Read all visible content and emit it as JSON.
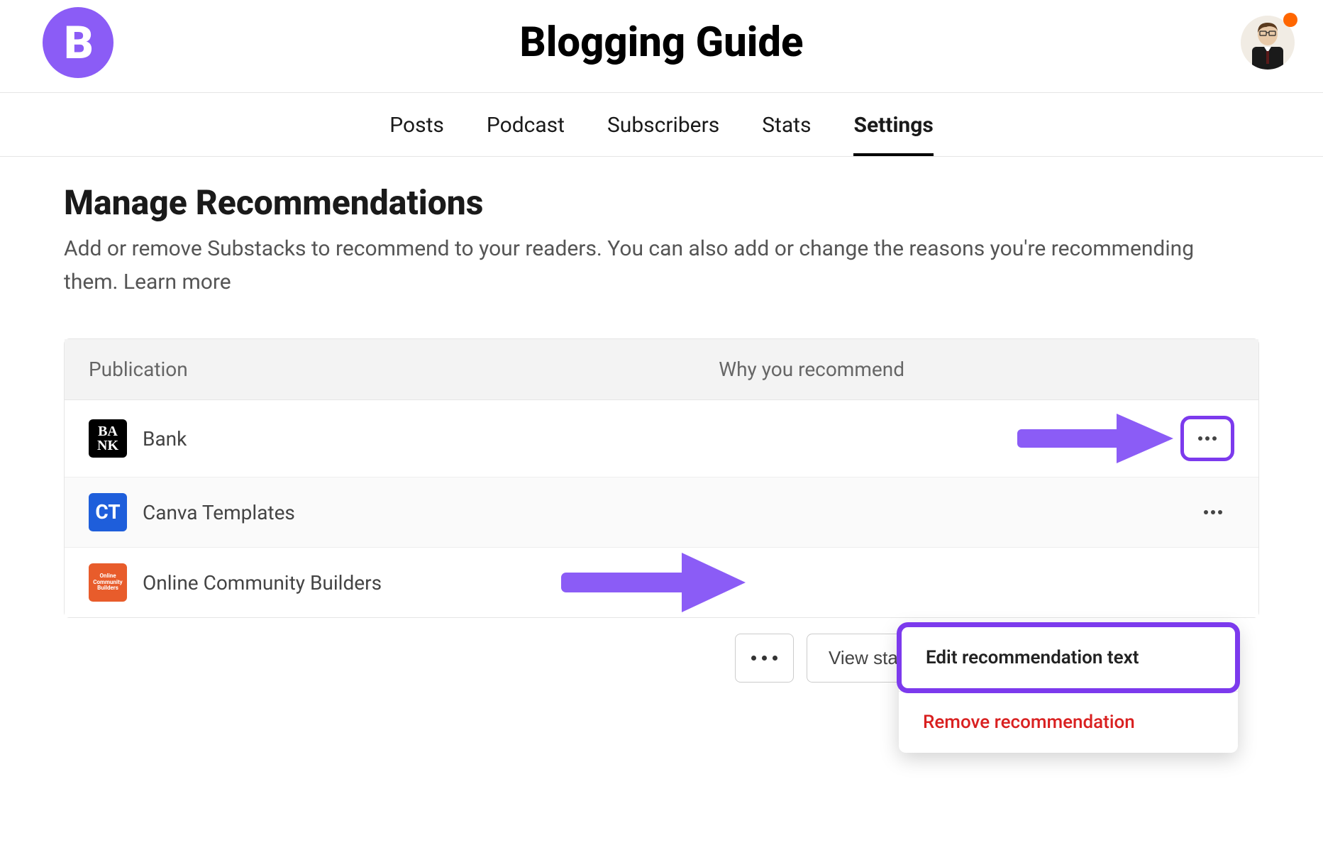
{
  "header": {
    "logo_text": "B",
    "site_title": "Blogging Guide"
  },
  "tabs": [
    {
      "label": "Posts",
      "active": false
    },
    {
      "label": "Podcast",
      "active": false
    },
    {
      "label": "Subscribers",
      "active": false
    },
    {
      "label": "Stats",
      "active": false
    },
    {
      "label": "Settings",
      "active": true
    }
  ],
  "page": {
    "title": "Manage Recommendations",
    "description": "Add or remove Substacks to recommend to your readers. You can also add or change the reasons you're recommending them. Learn more"
  },
  "table": {
    "columns": {
      "publication": "Publication",
      "why": "Why you recommend"
    },
    "rows": [
      {
        "name": "Bank",
        "icon_label": "BA NK"
      },
      {
        "name": "Canva Templates",
        "icon_label": "CT"
      },
      {
        "name": "Online Community Builders",
        "icon_label": "Online Community Builders"
      }
    ]
  },
  "popup": {
    "edit": "Edit recommendation text",
    "remove": "Remove recommendation"
  },
  "footer": {
    "view_stats": "View stats"
  },
  "colors": {
    "accent": "#7c3aed"
  }
}
